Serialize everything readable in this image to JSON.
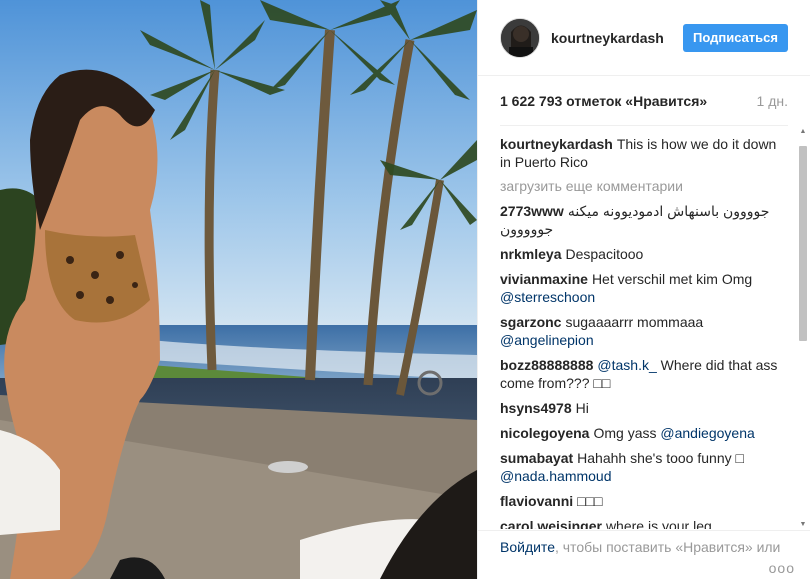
{
  "post": {
    "username": "kourtneykardash",
    "follow_label": "Подписаться",
    "likes": "1 622 793 отметок «Нравится»",
    "time": "1 дн.",
    "caption_text": "This is how we do it down in Puerto Rico",
    "load_more": "загрузить еще комментарии"
  },
  "comments": [
    {
      "user": "2773www",
      "text": "جوووون باسنهاش ادموديوونه ميكنه جووووون"
    },
    {
      "user": "nrkmleya",
      "text": "Despacitooo"
    },
    {
      "user": "vivianmaxine",
      "text": "Het verschil met kim Omg",
      "mention": "@sterreschoon"
    },
    {
      "user": "sgarzonc",
      "text": "sugaaaarrr mommaaa",
      "mention": "@angelinepion"
    },
    {
      "user": "bozz88888888",
      "mention": "@tash.k_",
      "text": "Where did that ass come from??? □□"
    },
    {
      "user": "hsyns4978",
      "text": "Hi"
    },
    {
      "user": "nicolegoyena",
      "text": "Omg yass",
      "mention": "@andiegoyena"
    },
    {
      "user": "sumabayat",
      "text": "Hahahh she's tooo funny □",
      "mention": "@nada.hammoud"
    },
    {
      "user": "flaviovanni",
      "text": "□□□"
    },
    {
      "user": "carol.weisinger",
      "text": "where is your leg"
    }
  ],
  "footer": {
    "login_link": "Войдите",
    "login_text": ", чтобы поставить «Нравится» или",
    "more_dots": "ооо"
  }
}
